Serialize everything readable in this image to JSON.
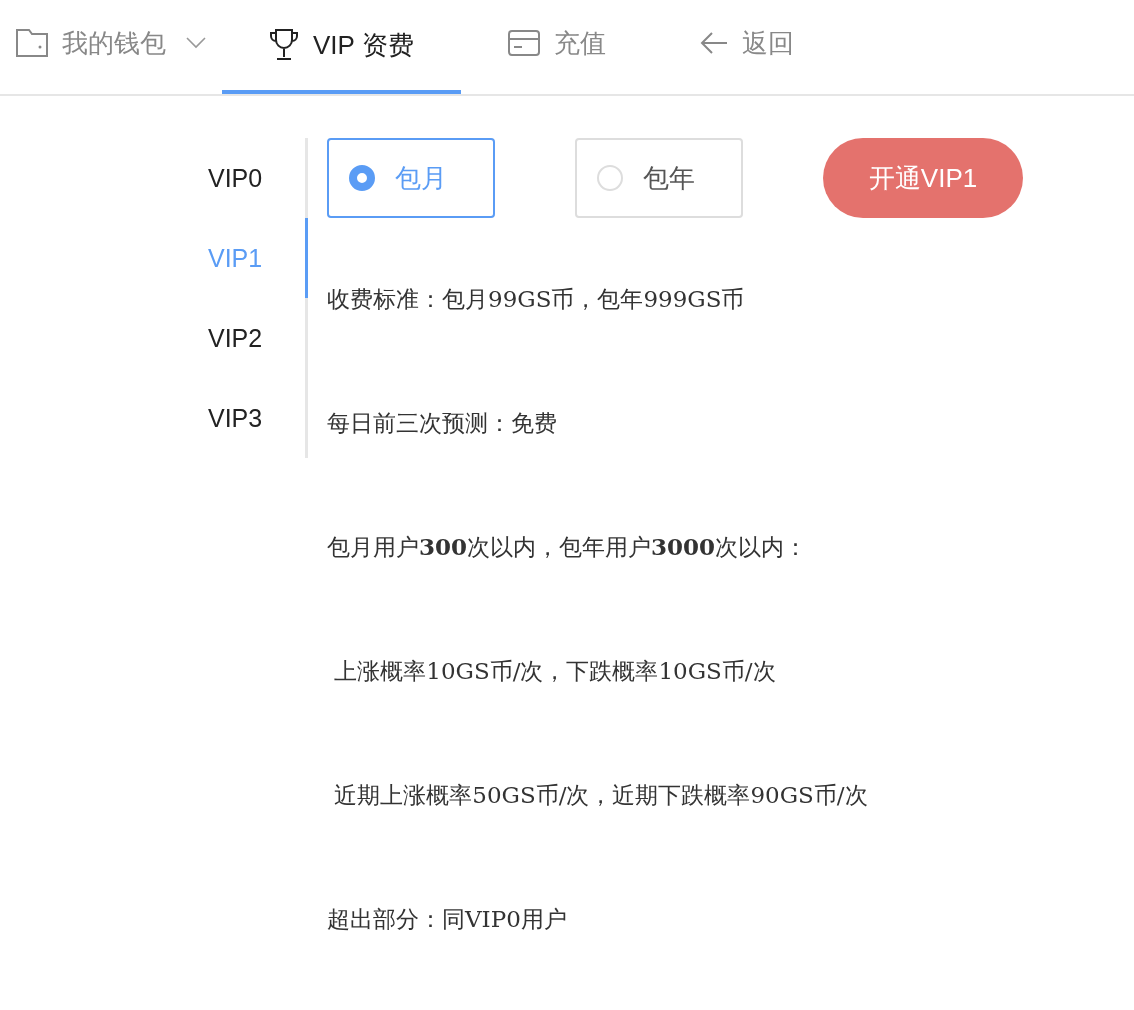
{
  "tabs": [
    {
      "kind": "wallet",
      "label": "我的钱包",
      "dropdown": true,
      "selected": false
    },
    {
      "kind": "trophy",
      "label": "VIP 资费",
      "dropdown": false,
      "selected": true
    },
    {
      "kind": "card",
      "label": "充值",
      "dropdown": false,
      "selected": false
    },
    {
      "kind": "back",
      "label": "返回",
      "dropdown": false,
      "selected": false
    }
  ],
  "levels": [
    {
      "label": "VIP0",
      "selected": false
    },
    {
      "label": "VIP1",
      "selected": true
    },
    {
      "label": "VIP2",
      "selected": false
    },
    {
      "label": "VIP3",
      "selected": false
    }
  ],
  "plans": [
    {
      "label": "包月",
      "selected": true
    },
    {
      "label": "包年",
      "selected": false
    }
  ],
  "open_button": "开通VIP1",
  "lines": [
    "收费标准：包月99GS币，包年999GS币",
    "每日前三次预测：免费",
    "包月用户**300**次以内，包年用户**3000**次以内：",
    " 上涨概率10GS币/次，下跌概率10GS币/次",
    " 近期上涨概率50GS币/次，近期下跌概率90GS币/次",
    "超出部分：同VIP0用户"
  ]
}
